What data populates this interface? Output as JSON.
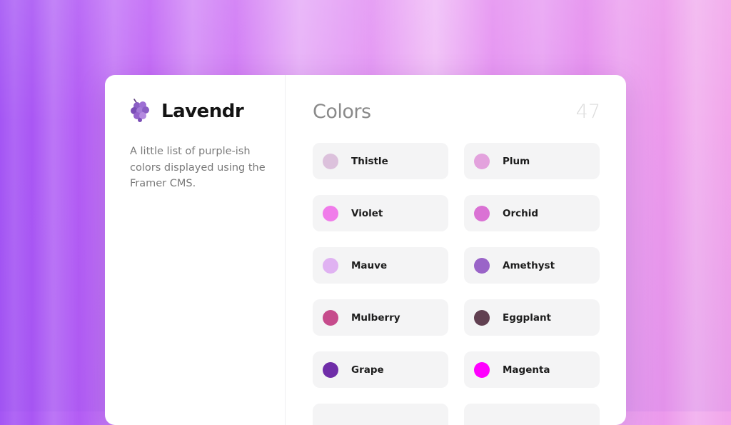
{
  "brand": {
    "name": "Lavendr",
    "icon": "grape-icon",
    "description": "A little list of purple-ish colors displayed using the Framer CMS."
  },
  "collection": {
    "title": "Colors",
    "count": "47"
  },
  "colors": [
    {
      "name": "Thistle",
      "hex": "#dcc1dc"
    },
    {
      "name": "Plum",
      "hex": "#e3a2dd"
    },
    {
      "name": "Violet",
      "hex": "#f07cea"
    },
    {
      "name": "Orchid",
      "hex": "#da72d4"
    },
    {
      "name": "Mauve",
      "hex": "#e0b2f2"
    },
    {
      "name": "Amethyst",
      "hex": "#9a64c8"
    },
    {
      "name": "Mulberry",
      "hex": "#c64b8c"
    },
    {
      "name": "Eggplant",
      "hex": "#614051"
    },
    {
      "name": "Grape",
      "hex": "#6f2da8"
    },
    {
      "name": "Magenta",
      "hex": "#ff00ff"
    },
    {
      "name": "",
      "hex": "#f4f4f5"
    },
    {
      "name": "",
      "hex": "#f4f4f5"
    }
  ]
}
